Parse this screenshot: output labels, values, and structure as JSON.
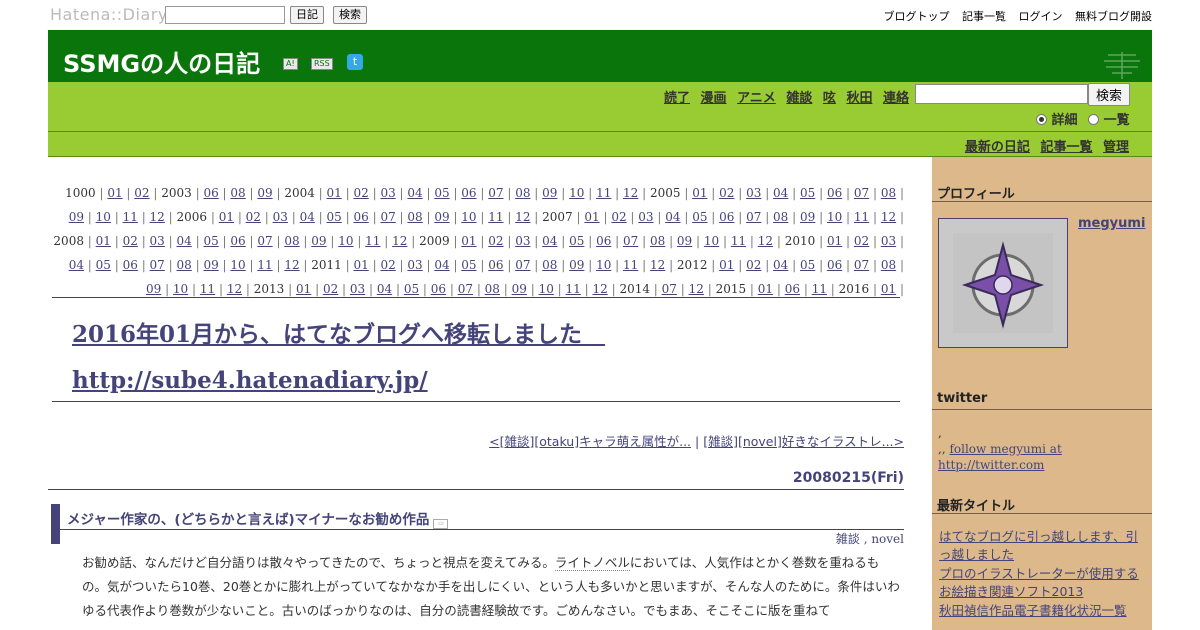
{
  "topbar": {
    "logo": "Hatena::Diary",
    "diary_button": "日記",
    "search_button": "検索",
    "links": [
      "ブログトップ",
      "記事一覧",
      "ログイン",
      "無料ブログ開設"
    ]
  },
  "header": {
    "title": "SSMGの人の日記",
    "icon_a": "A!",
    "icon_rss": "RSS",
    "icon_twitter": "t"
  },
  "nav": {
    "links": [
      "読了",
      "漫画",
      "アニメ",
      "雑談",
      "呟",
      "秋田",
      "連絡"
    ],
    "search_button": "検索",
    "radio_detail": "詳細",
    "radio_list": "一覧"
  },
  "subnav": {
    "links": [
      "最新の日記",
      "記事一覧",
      "管理"
    ]
  },
  "archive": [
    {
      "year": "1000",
      "months": [
        "01",
        "02"
      ]
    },
    {
      "year": "2003",
      "months": [
        "06",
        "08",
        "09"
      ]
    },
    {
      "year": "2004",
      "months": [
        "01",
        "02",
        "03",
        "04",
        "05",
        "06",
        "07",
        "08",
        "09",
        "10",
        "11",
        "12"
      ]
    },
    {
      "year": "2005",
      "months": [
        "01",
        "02",
        "03",
        "04",
        "05",
        "06",
        "07",
        "08",
        "09",
        "10",
        "11",
        "12"
      ]
    },
    {
      "year": "2006",
      "months": [
        "01",
        "02",
        "03",
        "04",
        "05",
        "06",
        "07",
        "08",
        "09",
        "10",
        "11",
        "12"
      ]
    },
    {
      "year": "2007",
      "months": [
        "01",
        "02",
        "03",
        "04",
        "05",
        "06",
        "07",
        "08",
        "09",
        "10",
        "11",
        "12"
      ]
    },
    {
      "year": "2008",
      "months": [
        "01",
        "02",
        "03",
        "04",
        "05",
        "06",
        "07",
        "08",
        "09",
        "10",
        "11",
        "12"
      ]
    },
    {
      "year": "2009",
      "months": [
        "01",
        "02",
        "03",
        "04",
        "05",
        "06",
        "07",
        "08",
        "09",
        "10",
        "11",
        "12"
      ]
    },
    {
      "year": "2010",
      "months": [
        "01",
        "02",
        "03",
        "04",
        "05",
        "06",
        "07",
        "08",
        "09",
        "10",
        "11",
        "12"
      ]
    },
    {
      "year": "2011",
      "months": [
        "01",
        "02",
        "03",
        "04",
        "05",
        "06",
        "07",
        "08",
        "09",
        "10",
        "11",
        "12"
      ]
    },
    {
      "year": "2012",
      "months": [
        "01",
        "02",
        "04",
        "05",
        "06",
        "07",
        "08",
        "09",
        "10",
        "11",
        "12"
      ]
    },
    {
      "year": "2013",
      "months": [
        "01",
        "02",
        "03",
        "04",
        "05",
        "06",
        "07",
        "08",
        "09",
        "10",
        "11",
        "12"
      ]
    },
    {
      "year": "2014",
      "months": [
        "07",
        "12"
      ]
    },
    {
      "year": "2015",
      "months": [
        "01",
        "06",
        "11"
      ]
    },
    {
      "year": "2016",
      "months": [
        "01"
      ]
    }
  ],
  "announce": {
    "line1": "2016年01月から、はてなブログへ移転しました　",
    "line2": "http://sube4.hatenadiary.jp/"
  },
  "pager": {
    "prev": "<[雑談][otaku]キャラ萌え属性が...",
    "sep": " | ",
    "next": "[雑談][novel]好きなイラストレ...>"
  },
  "entry": {
    "date": "20080215(Fri)",
    "title": "メジャー作家の、(どちらかと言えば)マイナーなお勧め作品",
    "cat1": "雑談",
    "cat2": "novel",
    "body_pre": "お勧め話、なんだけど自分語りは散々やってきたので、ちょっと視点を変えてみる。",
    "keyword": "ライトノベル",
    "body_post": "においては、人気作はとかく巻数を重ねるもの。気がついたら10巻、20巻とかに膨れ上がっていてなかなか手を出しにくい、という人も多いかと思いますが、そんな人のために。条件はいわゆる代表作より巻数が少ないこと。古いのばっかりなのは、自分の読書経験故です。ごめんなさい。でもまあ、そこそこに版を重ねて"
  },
  "sidebar": {
    "profile_heading": "プロフィール",
    "profile_name": "megyumi",
    "twitter_heading": "twitter",
    "twitter_line1": ",",
    "twitter_prefix": ",, ",
    "twitter_link": "follow megyumi at http://twitter.com",
    "recent_heading": "最新タイトル",
    "recent": [
      "はてなブログに引っ越しします、引っ越しました",
      "プロのイラストレーターが使用するお絵描き関連ソフト2013",
      "秋田禎信作品電子書籍化状況一覧"
    ]
  },
  "colors": {
    "header_green": "#0a750a",
    "nav_green": "#99cc33",
    "sidebar_tan": "#dcb88a",
    "link": "#44447a"
  }
}
